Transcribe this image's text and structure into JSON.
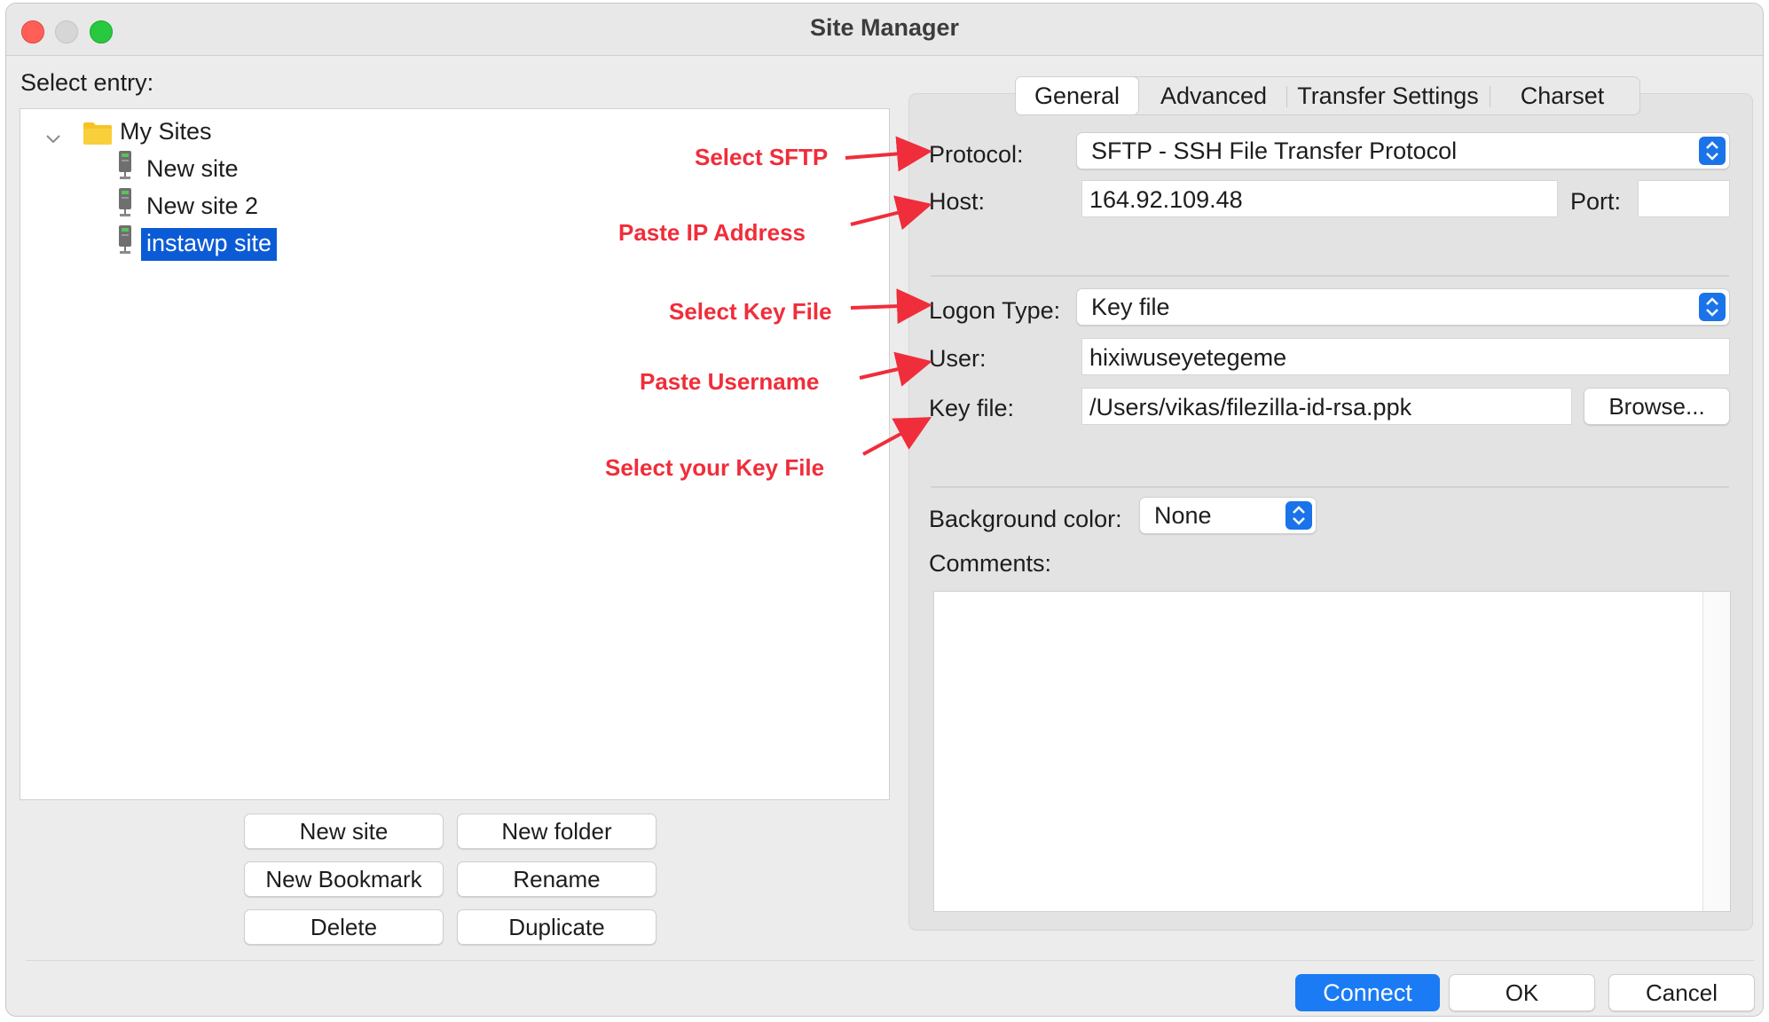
{
  "window": {
    "title": "Site Manager"
  },
  "left": {
    "select_entry_label": "Select entry:",
    "tree": {
      "root": "My Sites",
      "items": [
        "New site",
        "New site 2",
        "instawp site"
      ],
      "selected_index": 2
    },
    "buttons": {
      "new_site": "New site",
      "new_folder": "New folder",
      "new_bookmark": "New Bookmark",
      "rename": "Rename",
      "delete": "Delete",
      "duplicate": "Duplicate"
    }
  },
  "tabs": [
    {
      "label": "General",
      "active": true
    },
    {
      "label": "Advanced",
      "active": false
    },
    {
      "label": "Transfer Settings",
      "active": false
    },
    {
      "label": "Charset",
      "active": false
    }
  ],
  "general": {
    "protocol_label": "Protocol:",
    "protocol_value": "SFTP - SSH File Transfer Protocol",
    "host_label": "Host:",
    "host_value": "164.92.109.48",
    "port_label": "Port:",
    "port_value": "",
    "logon_type_label": "Logon Type:",
    "logon_type_value": "Key file",
    "user_label": "User:",
    "user_value": "hixiwuseyetegeme",
    "key_file_label": "Key file:",
    "key_file_value": "/Users/vikas/filezilla-id-rsa.ppk",
    "browse_label": "Browse...",
    "bg_color_label": "Background color:",
    "bg_color_value": "None",
    "comments_label": "Comments:",
    "comments_value": ""
  },
  "annotations": {
    "select_sftp": "Select SFTP",
    "paste_ip": "Paste IP Address",
    "select_key_file": "Select Key File",
    "paste_username": "Paste Username",
    "select_your_key_file": "Select your Key File"
  },
  "footer": {
    "connect": "Connect",
    "ok": "OK",
    "cancel": "Cancel"
  },
  "colors": {
    "accent": "#1a7bf5",
    "selection": "#0c5bd6",
    "annotation": "#f02d3a",
    "folder": "#f7c325"
  },
  "icons": [
    "folder-icon",
    "server-icon",
    "chevron-down-icon",
    "updown-arrows-icon"
  ]
}
